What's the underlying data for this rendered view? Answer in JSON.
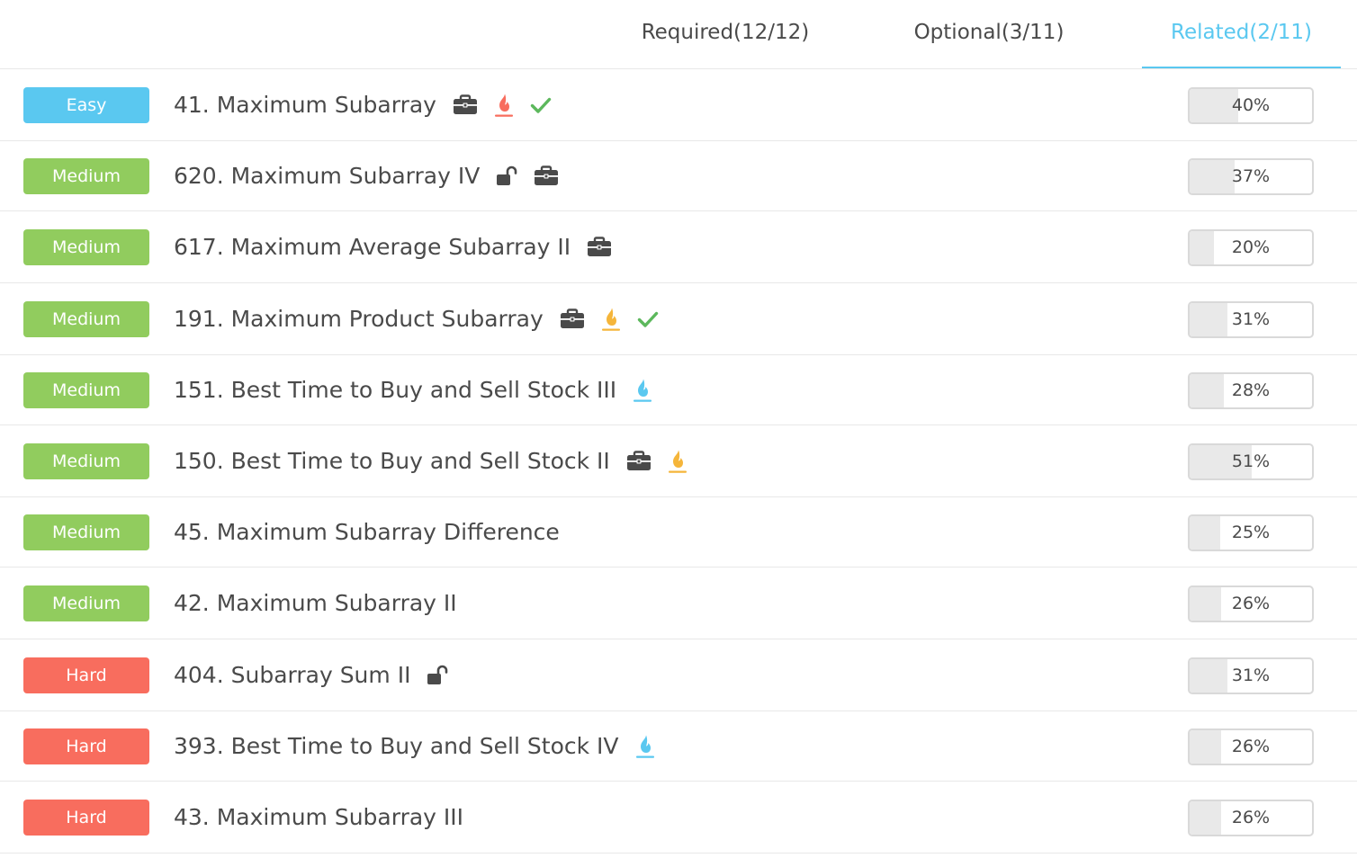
{
  "tabs": [
    {
      "label": "Required(12/12)",
      "active": false
    },
    {
      "label": "Optional(3/11)",
      "active": false
    },
    {
      "label": "Related(2/11)",
      "active": true
    }
  ],
  "colors": {
    "accent": "#5ac8f0",
    "easy": "#5ac8f0",
    "medium": "#91cc5e",
    "hard": "#f86d5e",
    "flame_red": "#f86d5e",
    "flame_orange": "#f5b53a",
    "flame_blue": "#5ac8f0",
    "check_green": "#5cb85c"
  },
  "problems": [
    {
      "difficulty": "Easy",
      "level": "easy",
      "title": "41. Maximum Subarray",
      "icons": [
        "briefcase-icon",
        "flame-red-icon",
        "check-icon"
      ],
      "acceptance": "40%",
      "acceptance_value": 0.4
    },
    {
      "difficulty": "Medium",
      "level": "medium",
      "title": "620. Maximum Subarray IV",
      "icons": [
        "unlock-icon",
        "briefcase-icon"
      ],
      "acceptance": "37%",
      "acceptance_value": 0.37
    },
    {
      "difficulty": "Medium",
      "level": "medium",
      "title": "617. Maximum Average Subarray II",
      "icons": [
        "briefcase-icon"
      ],
      "acceptance": "20%",
      "acceptance_value": 0.2
    },
    {
      "difficulty": "Medium",
      "level": "medium",
      "title": "191. Maximum Product Subarray",
      "icons": [
        "briefcase-icon",
        "flame-orange-icon",
        "check-icon"
      ],
      "acceptance": "31%",
      "acceptance_value": 0.31
    },
    {
      "difficulty": "Medium",
      "level": "medium",
      "title": "151. Best Time to Buy and Sell Stock III",
      "icons": [
        "flame-blue-icon"
      ],
      "acceptance": "28%",
      "acceptance_value": 0.28
    },
    {
      "difficulty": "Medium",
      "level": "medium",
      "title": "150. Best Time to Buy and Sell Stock II",
      "icons": [
        "briefcase-icon",
        "flame-orange-icon"
      ],
      "acceptance": "51%",
      "acceptance_value": 0.51
    },
    {
      "difficulty": "Medium",
      "level": "medium",
      "title": "45. Maximum Subarray Difference",
      "icons": [],
      "acceptance": "25%",
      "acceptance_value": 0.25
    },
    {
      "difficulty": "Medium",
      "level": "medium",
      "title": "42. Maximum Subarray II",
      "icons": [],
      "acceptance": "26%",
      "acceptance_value": 0.26
    },
    {
      "difficulty": "Hard",
      "level": "hard",
      "title": "404. Subarray Sum II",
      "icons": [
        "unlock-icon"
      ],
      "acceptance": "31%",
      "acceptance_value": 0.31
    },
    {
      "difficulty": "Hard",
      "level": "hard",
      "title": "393. Best Time to Buy and Sell Stock IV",
      "icons": [
        "flame-blue-icon"
      ],
      "acceptance": "26%",
      "acceptance_value": 0.26
    },
    {
      "difficulty": "Hard",
      "level": "hard",
      "title": "43. Maximum Subarray III",
      "icons": [],
      "acceptance": "26%",
      "acceptance_value": 0.26
    }
  ]
}
